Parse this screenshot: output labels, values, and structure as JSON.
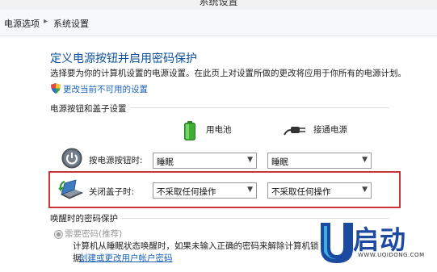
{
  "window": {
    "title": "系统设置"
  },
  "breadcrumb": {
    "items": [
      "电源选项",
      "系统设置"
    ]
  },
  "page": {
    "heading": "定义电源按钮并启用密码保护",
    "description": "选择要为你的计算机设置的电源设置。在此页上对设置所做的更改将应用于你所有的电源计划。",
    "change_link": "更改当前不可用的设置"
  },
  "power_section": {
    "label": "电源按钮和盖子设置",
    "columns": {
      "battery": "用电池",
      "plugged_in": "接通电源"
    },
    "rows": [
      {
        "label": "按电源按钮时:",
        "battery_value": "睡眠",
        "plugged_value": "睡眠"
      },
      {
        "label": "关闭盖子时:",
        "battery_value": "不采取任何操作",
        "plugged_value": "不采取任何操作"
      }
    ]
  },
  "password_section": {
    "label": "唤醒时的密码保护",
    "option_label": "需要密码(推荐)",
    "line1": "计算机从睡眠状态唤醒时，如果未输入正确的密码来解除计算机锁",
    "line2_prefix": "据。",
    "link": "创建或更改用户帐户密码"
  },
  "watermark": {
    "brand_letter": "U",
    "brand_text": "启动",
    "url": "WWW.UQIDONG.COM",
    "brand_color": "#1b4aa0"
  },
  "colors": {
    "highlight": "#c8363a",
    "heading": "#0b4f9c",
    "link": "#1c63b7"
  }
}
